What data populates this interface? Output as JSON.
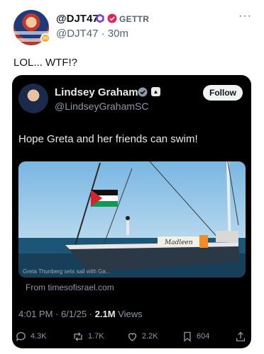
{
  "post": {
    "author_name": "@DJT47",
    "platform_label": "GETTR",
    "handle": "@DJT47",
    "time": "30m",
    "more_label": "···",
    "text": "LOL... WTF!?"
  },
  "quoted": {
    "author_name": "Lindsey Graham",
    "handle": "@LindseyGrahamSC",
    "follow_label": "Follow",
    "text": "Hope Greta and her friends can swim!",
    "media_caption": "Greta Thunberg sets sail with Ga...",
    "boat_name": "Madleen",
    "source": "From timesofisrael.com",
    "time": "4:01 PM",
    "date": "6/1/25",
    "views_count": "2.1M",
    "views_label": "Views",
    "actions": {
      "replies": "4.3K",
      "reposts": "1.7K",
      "likes": "2.2K",
      "bookmarks": "604"
    }
  },
  "colors": {
    "verified_blue": "#1d9bf0",
    "badge_purple": "#7b3fe4",
    "badge_red": "#e0245e",
    "quote_bg": "#000000"
  },
  "icons": [
    "dots-icon",
    "verified-icon",
    "reply-icon",
    "repost-icon",
    "like-icon",
    "bookmark-icon",
    "share-icon"
  ]
}
